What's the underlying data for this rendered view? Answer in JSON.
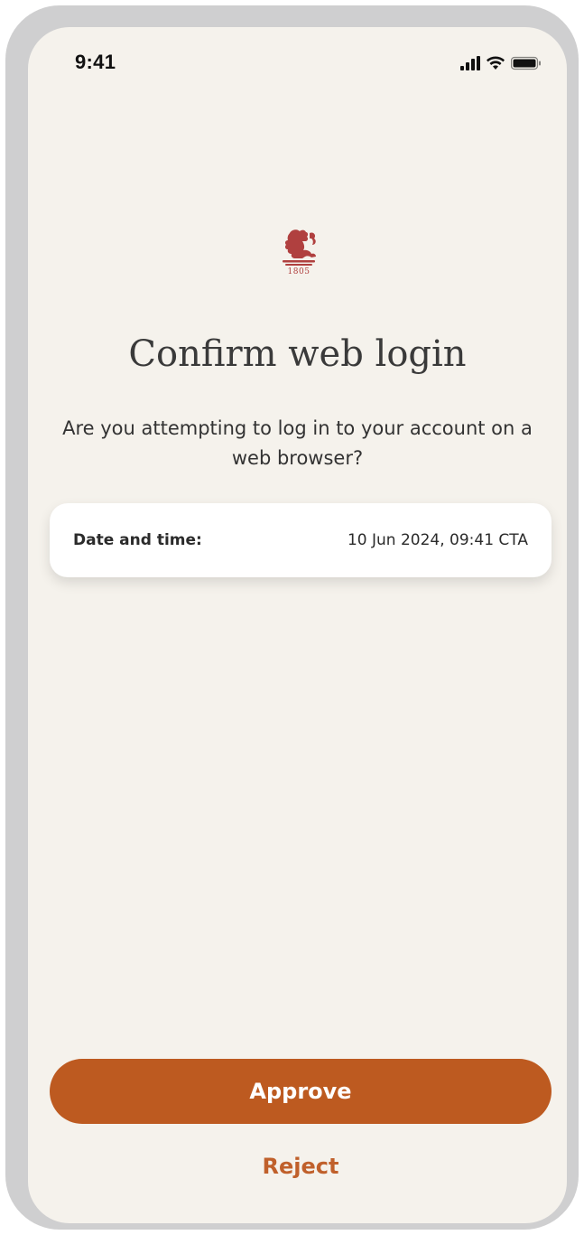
{
  "status_bar": {
    "time": "9:41"
  },
  "logo": {
    "year": "1805",
    "color": "#b0403f"
  },
  "page": {
    "title": "Confirm web login",
    "subtitle": "Are you attempting to log in to your account on a web browser?"
  },
  "details": {
    "label": "Date and time:",
    "value": "10 Jun 2024, 09:41 CTA"
  },
  "actions": {
    "approve_label": "Approve",
    "reject_label": "Reject",
    "approve_color": "#bd5a20",
    "reject_color": "#c0602b"
  },
  "colors": {
    "background": "#f5f2ec",
    "frame": "#cfcfd0"
  }
}
